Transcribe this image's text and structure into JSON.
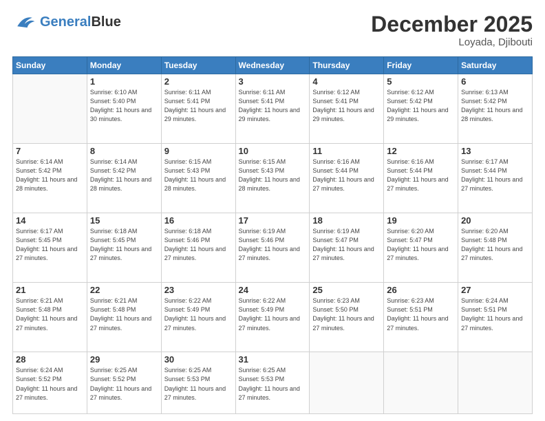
{
  "header": {
    "logo_general": "General",
    "logo_blue": "Blue",
    "month_title": "December 2025",
    "location": "Loyada, Djibouti"
  },
  "weekdays": [
    "Sunday",
    "Monday",
    "Tuesday",
    "Wednesday",
    "Thursday",
    "Friday",
    "Saturday"
  ],
  "weeks": [
    [
      {
        "day": "",
        "sunrise": "",
        "sunset": "",
        "daylight": ""
      },
      {
        "day": "1",
        "sunrise": "Sunrise: 6:10 AM",
        "sunset": "Sunset: 5:40 PM",
        "daylight": "Daylight: 11 hours and 30 minutes."
      },
      {
        "day": "2",
        "sunrise": "Sunrise: 6:11 AM",
        "sunset": "Sunset: 5:41 PM",
        "daylight": "Daylight: 11 hours and 29 minutes."
      },
      {
        "day": "3",
        "sunrise": "Sunrise: 6:11 AM",
        "sunset": "Sunset: 5:41 PM",
        "daylight": "Daylight: 11 hours and 29 minutes."
      },
      {
        "day": "4",
        "sunrise": "Sunrise: 6:12 AM",
        "sunset": "Sunset: 5:41 PM",
        "daylight": "Daylight: 11 hours and 29 minutes."
      },
      {
        "day": "5",
        "sunrise": "Sunrise: 6:12 AM",
        "sunset": "Sunset: 5:42 PM",
        "daylight": "Daylight: 11 hours and 29 minutes."
      },
      {
        "day": "6",
        "sunrise": "Sunrise: 6:13 AM",
        "sunset": "Sunset: 5:42 PM",
        "daylight": "Daylight: 11 hours and 28 minutes."
      }
    ],
    [
      {
        "day": "7",
        "sunrise": "Sunrise: 6:14 AM",
        "sunset": "Sunset: 5:42 PM",
        "daylight": "Daylight: 11 hours and 28 minutes."
      },
      {
        "day": "8",
        "sunrise": "Sunrise: 6:14 AM",
        "sunset": "Sunset: 5:42 PM",
        "daylight": "Daylight: 11 hours and 28 minutes."
      },
      {
        "day": "9",
        "sunrise": "Sunrise: 6:15 AM",
        "sunset": "Sunset: 5:43 PM",
        "daylight": "Daylight: 11 hours and 28 minutes."
      },
      {
        "day": "10",
        "sunrise": "Sunrise: 6:15 AM",
        "sunset": "Sunset: 5:43 PM",
        "daylight": "Daylight: 11 hours and 28 minutes."
      },
      {
        "day": "11",
        "sunrise": "Sunrise: 6:16 AM",
        "sunset": "Sunset: 5:44 PM",
        "daylight": "Daylight: 11 hours and 27 minutes."
      },
      {
        "day": "12",
        "sunrise": "Sunrise: 6:16 AM",
        "sunset": "Sunset: 5:44 PM",
        "daylight": "Daylight: 11 hours and 27 minutes."
      },
      {
        "day": "13",
        "sunrise": "Sunrise: 6:17 AM",
        "sunset": "Sunset: 5:44 PM",
        "daylight": "Daylight: 11 hours and 27 minutes."
      }
    ],
    [
      {
        "day": "14",
        "sunrise": "Sunrise: 6:17 AM",
        "sunset": "Sunset: 5:45 PM",
        "daylight": "Daylight: 11 hours and 27 minutes."
      },
      {
        "day": "15",
        "sunrise": "Sunrise: 6:18 AM",
        "sunset": "Sunset: 5:45 PM",
        "daylight": "Daylight: 11 hours and 27 minutes."
      },
      {
        "day": "16",
        "sunrise": "Sunrise: 6:18 AM",
        "sunset": "Sunset: 5:46 PM",
        "daylight": "Daylight: 11 hours and 27 minutes."
      },
      {
        "day": "17",
        "sunrise": "Sunrise: 6:19 AM",
        "sunset": "Sunset: 5:46 PM",
        "daylight": "Daylight: 11 hours and 27 minutes."
      },
      {
        "day": "18",
        "sunrise": "Sunrise: 6:19 AM",
        "sunset": "Sunset: 5:47 PM",
        "daylight": "Daylight: 11 hours and 27 minutes."
      },
      {
        "day": "19",
        "sunrise": "Sunrise: 6:20 AM",
        "sunset": "Sunset: 5:47 PM",
        "daylight": "Daylight: 11 hours and 27 minutes."
      },
      {
        "day": "20",
        "sunrise": "Sunrise: 6:20 AM",
        "sunset": "Sunset: 5:48 PM",
        "daylight": "Daylight: 11 hours and 27 minutes."
      }
    ],
    [
      {
        "day": "21",
        "sunrise": "Sunrise: 6:21 AM",
        "sunset": "Sunset: 5:48 PM",
        "daylight": "Daylight: 11 hours and 27 minutes."
      },
      {
        "day": "22",
        "sunrise": "Sunrise: 6:21 AM",
        "sunset": "Sunset: 5:48 PM",
        "daylight": "Daylight: 11 hours and 27 minutes."
      },
      {
        "day": "23",
        "sunrise": "Sunrise: 6:22 AM",
        "sunset": "Sunset: 5:49 PM",
        "daylight": "Daylight: 11 hours and 27 minutes."
      },
      {
        "day": "24",
        "sunrise": "Sunrise: 6:22 AM",
        "sunset": "Sunset: 5:49 PM",
        "daylight": "Daylight: 11 hours and 27 minutes."
      },
      {
        "day": "25",
        "sunrise": "Sunrise: 6:23 AM",
        "sunset": "Sunset: 5:50 PM",
        "daylight": "Daylight: 11 hours and 27 minutes."
      },
      {
        "day": "26",
        "sunrise": "Sunrise: 6:23 AM",
        "sunset": "Sunset: 5:51 PM",
        "daylight": "Daylight: 11 hours and 27 minutes."
      },
      {
        "day": "27",
        "sunrise": "Sunrise: 6:24 AM",
        "sunset": "Sunset: 5:51 PM",
        "daylight": "Daylight: 11 hours and 27 minutes."
      }
    ],
    [
      {
        "day": "28",
        "sunrise": "Sunrise: 6:24 AM",
        "sunset": "Sunset: 5:52 PM",
        "daylight": "Daylight: 11 hours and 27 minutes."
      },
      {
        "day": "29",
        "sunrise": "Sunrise: 6:25 AM",
        "sunset": "Sunset: 5:52 PM",
        "daylight": "Daylight: 11 hours and 27 minutes."
      },
      {
        "day": "30",
        "sunrise": "Sunrise: 6:25 AM",
        "sunset": "Sunset: 5:53 PM",
        "daylight": "Daylight: 11 hours and 27 minutes."
      },
      {
        "day": "31",
        "sunrise": "Sunrise: 6:25 AM",
        "sunset": "Sunset: 5:53 PM",
        "daylight": "Daylight: 11 hours and 27 minutes."
      },
      {
        "day": "",
        "sunrise": "",
        "sunset": "",
        "daylight": ""
      },
      {
        "day": "",
        "sunrise": "",
        "sunset": "",
        "daylight": ""
      },
      {
        "day": "",
        "sunrise": "",
        "sunset": "",
        "daylight": ""
      }
    ]
  ]
}
